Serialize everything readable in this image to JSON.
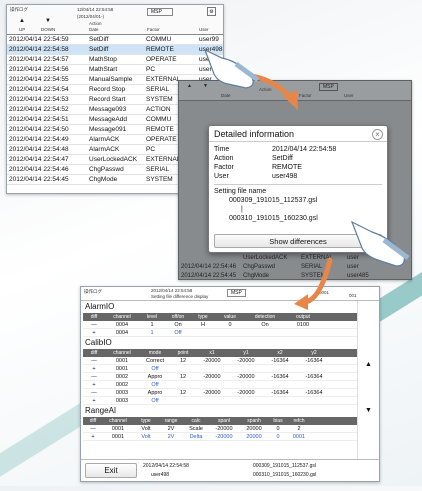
{
  "screen1": {
    "header": {
      "title_small": "操作ログ",
      "center_small": "12/04/14 22:54:58",
      "range_small": "(2012/04/01-)",
      "up_label": "UP",
      "down_label": "DOWN",
      "col_date": "Date",
      "col_action": "Action",
      "col_factor": "Factor",
      "col_user": "User",
      "badge": "MSP"
    },
    "rows": [
      {
        "dt": "2012/04/14 22:54:59",
        "ev": "SetDiff",
        "fa": "COMMU",
        "us": "user99"
      },
      {
        "dt": "2012/04/14 22:54:58",
        "ev": "SetDiff",
        "fa": "REMOTE",
        "us": "user498"
      },
      {
        "dt": "2012/04/14 22:54:57",
        "ev": "MathStop",
        "fa": "OPERATE",
        "us": "user97"
      },
      {
        "dt": "2012/04/14 22:54:56",
        "ev": "MathStart",
        "fa": "PC",
        "us": "user"
      },
      {
        "dt": "2012/04/14 22:54:55",
        "ev": "ManualSample",
        "fa": "EXTERNAL",
        "us": "user"
      },
      {
        "dt": "2012/04/14 22:54:54",
        "ev": "Record Stop",
        "fa": "SERIAL",
        "us": "user"
      },
      {
        "dt": "2012/04/14 22:54:53",
        "ev": "Record Start",
        "fa": "SYSTEM",
        "us": "user"
      },
      {
        "dt": "2012/04/14 22:54:52",
        "ev": "Message093",
        "fa": "ACTION",
        "us": "user"
      },
      {
        "dt": "2012/04/14 22:54:51",
        "ev": "MessageAdd",
        "fa": "COMMU",
        "us": "user"
      },
      {
        "dt": "2012/04/14 22:54:50",
        "ev": "Message091",
        "fa": "REMOTE",
        "us": "user"
      },
      {
        "dt": "2012/04/14 22:54:49",
        "ev": "AlarmACK",
        "fa": "OPERATE",
        "us": "user"
      },
      {
        "dt": "2012/04/14 22:54:48",
        "ev": "AlarmACK",
        "fa": "PC",
        "us": "user"
      },
      {
        "dt": "2012/04/14 22:54:47",
        "ev": "UserLockedACK",
        "fa": "EXTERNAL",
        "us": "user"
      },
      {
        "dt": "2012/04/14 22:54:46",
        "ev": "ChgPasswd",
        "fa": "SERIAL",
        "us": "user"
      },
      {
        "dt": "2012/04/14 22:54:45",
        "ev": "ChgMode",
        "fa": "SYSTEM",
        "us": "user"
      }
    ]
  },
  "screen2": {
    "header": {
      "col_date": "Date",
      "col_action": "Action",
      "col_factor": "Factor",
      "col_user": "User",
      "badge": "MSP"
    },
    "bottom_rows": [
      {
        "ev": "UserLockedACK",
        "fa": "EXTERNAL",
        "us": "user"
      },
      {
        "dt": "2012/04/14 22:54:46",
        "ev": "ChgPasswd",
        "fa": "SERIAL",
        "us": "user"
      },
      {
        "dt": "2012/04/14 22:54:45",
        "ev": "ChgMode",
        "fa": "SYSTEM",
        "us": "user485"
      }
    ],
    "dialog": {
      "title": "Detailed information",
      "time_label": "Time",
      "time_value": "2012/04/14 22:54:58",
      "action_label": "Action",
      "action_value": "SetDiff",
      "factor_label": "Factor",
      "factor_value": "REMOTE",
      "user_label": "User",
      "user_value": "user498",
      "file_label": "Setting file name",
      "file1": "000309_191015_112537.gsl",
      "file2": "000310_191015_160230.gsl",
      "button": "Show differences"
    }
  },
  "screen3": {
    "header": {
      "left_small": "操作ログ",
      "center_small": "2012/04/14 22:54:58",
      "center_small2": "Setting file difference display",
      "badge": "MSP",
      "counter": "0001",
      "counter2": "001"
    },
    "alarm": {
      "title": "AlarmIO",
      "cols": [
        "diff",
        "channel",
        "level",
        "off/on",
        "type",
        "value",
        "detection",
        "output"
      ],
      "rows": [
        {
          "diff": "—",
          "ch": "0004",
          "lv": "1",
          "on": "On",
          "ty": "H",
          "va": "0",
          "de": "On",
          "ou": "0100"
        },
        {
          "diff": "+",
          "ch": "0004",
          "lv": "1",
          "on": "Off",
          "ty": "",
          "va": "",
          "de": "",
          "ou": ""
        }
      ]
    },
    "calib": {
      "title": "CalibIO",
      "cols": [
        "diff",
        "channel",
        "mode",
        "point",
        "x1",
        "y1",
        "x2",
        "y2"
      ],
      "rows": [
        {
          "diff": "—",
          "ch": "0001",
          "mo": "Correct",
          "pt": "12",
          "x1": "-20000",
          "y1": "-20000",
          "x2": "-16364",
          "y2": "-16364"
        },
        {
          "diff": "+",
          "ch": "0001",
          "mo": "Off",
          "pt": "",
          "x1": "",
          "y1": "",
          "x2": "",
          "y2": ""
        },
        {
          "diff": "—",
          "ch": "0002",
          "mo": "Appro",
          "pt": "12",
          "x1": "-20000",
          "y1": "-20000",
          "x2": "-16364",
          "y2": "-16364"
        },
        {
          "diff": "+",
          "ch": "0002",
          "mo": "Off",
          "pt": "",
          "x1": "",
          "y1": "",
          "x2": "",
          "y2": ""
        },
        {
          "diff": "—",
          "ch": "0003",
          "mo": "Appro",
          "pt": "12",
          "x1": "-20000",
          "y1": "-20000",
          "x2": "-16364",
          "y2": "-16364"
        },
        {
          "diff": "+",
          "ch": "0003",
          "mo": "Off",
          "pt": "",
          "x1": "",
          "y1": "",
          "x2": "",
          "y2": ""
        }
      ]
    },
    "range": {
      "title": "RangeAI",
      "cols": [
        "diff",
        "channel",
        "type",
        "range",
        "calc",
        "spanl",
        "spanh",
        "bias",
        "refch"
      ],
      "rows": [
        {
          "diff": "—",
          "ch": "0001",
          "ty": "Volt",
          "ra": "2V",
          "ca": "Scale",
          "sl": "-20000",
          "sh": "20000",
          "bi": "0",
          "rf": "2"
        },
        {
          "diff": "+",
          "ch": "0001",
          "ty": "Volt",
          "ra": "2V",
          "ca": "Delta",
          "sl": "-20000",
          "sh": "20000",
          "bi": "0",
          "rf": "0001"
        }
      ]
    },
    "footer": {
      "exit": "Exit",
      "time": "2012/04/14 22:54:58",
      "user": "user498",
      "file1": "000309_191015_112537.gsl",
      "file2": "000310_191015_160230.gsl"
    }
  },
  "colors": {
    "accent_orange": "#e8864a",
    "table_header": "#666666",
    "diff_blue": "#2a60c8",
    "selected_row": "#cfe3f6"
  }
}
